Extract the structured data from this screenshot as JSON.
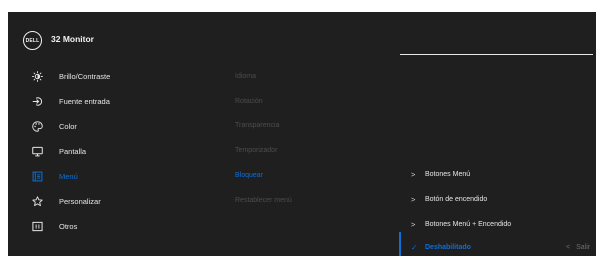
{
  "header": {
    "logo_text": "DELL",
    "title": "32 Monitor"
  },
  "menu": [
    {
      "id": "brightness",
      "label": "Brillo/Contraste",
      "icon": "brightness-icon"
    },
    {
      "id": "input",
      "label": "Fuente entrada",
      "icon": "input-source-icon"
    },
    {
      "id": "color",
      "label": "Color",
      "icon": "palette-icon"
    },
    {
      "id": "display",
      "label": "Pantalla",
      "icon": "monitor-icon"
    },
    {
      "id": "menu",
      "label": "Menú",
      "icon": "menu-icon",
      "active": true
    },
    {
      "id": "personalize",
      "label": "Personalizar",
      "icon": "star-icon"
    },
    {
      "id": "others",
      "label": "Otros",
      "icon": "others-icon"
    }
  ],
  "submenu": [
    {
      "label": "Idioma"
    },
    {
      "label": "Rotación"
    },
    {
      "label": "Transparencia"
    },
    {
      "label": "Temporizador"
    },
    {
      "label": "Bloquear",
      "active": true
    },
    {
      "label": "Restablecer menú"
    }
  ],
  "options": [
    {
      "label": "Botones Menú",
      "marker": ">"
    },
    {
      "label": "Botón de encendido",
      "marker": ">"
    },
    {
      "label": "Botones Menú + Encendido",
      "marker": ">"
    },
    {
      "label": "Deshabilitado",
      "marker": "✓",
      "selected": true
    }
  ],
  "exit": {
    "arrow": "<",
    "label": "Salir"
  },
  "colors": {
    "accent": "#0e6fd4",
    "background": "#1f1f1f",
    "text": "#e6e6e6",
    "disabled_text": "#4d4d4d"
  }
}
